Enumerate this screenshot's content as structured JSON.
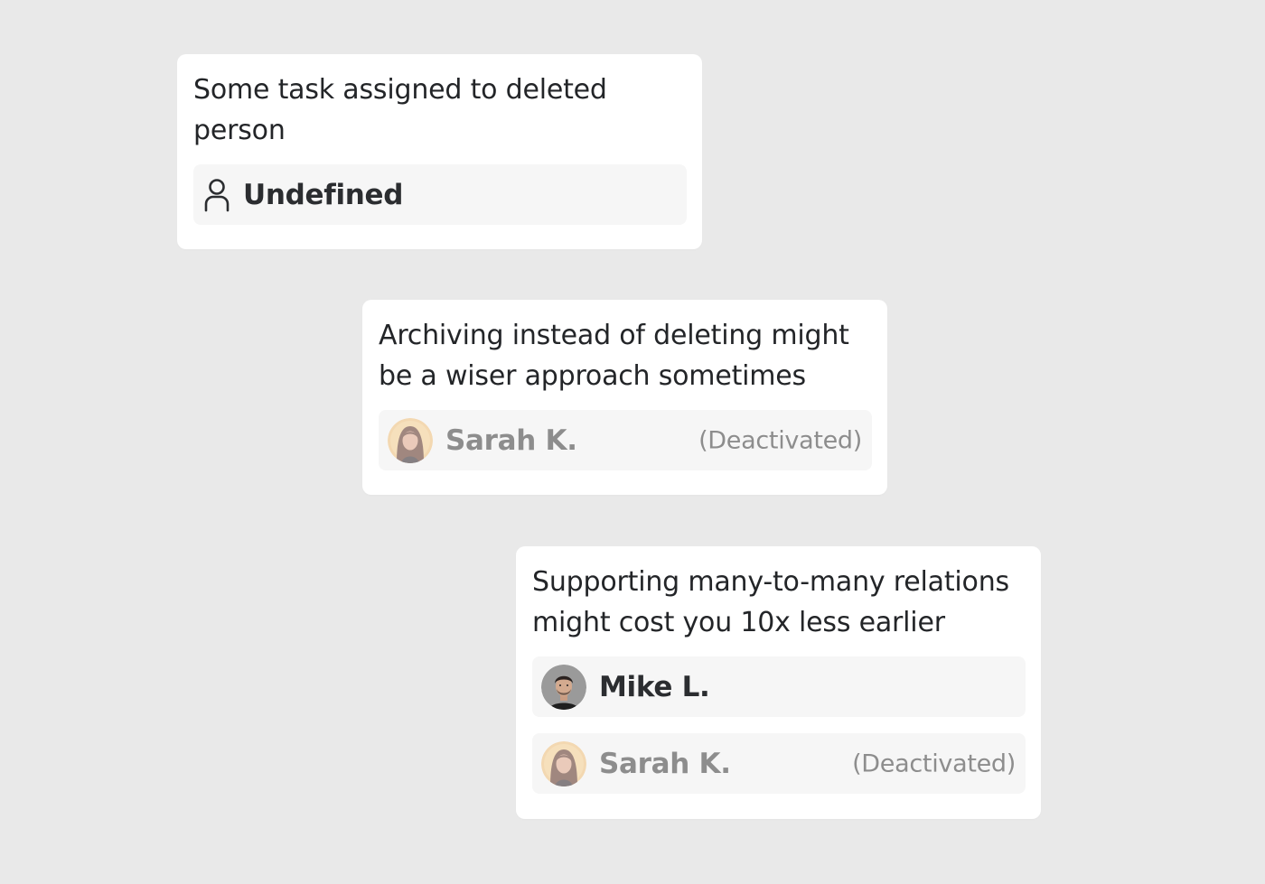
{
  "cards": [
    {
      "title_line1": "Some task assigned to deleted",
      "title_line2": "person",
      "assignees": [
        {
          "name": "Undefined",
          "icon": "user-outline-icon"
        }
      ]
    },
    {
      "title_line1": "Archiving instead of deleting might",
      "title_line2": "be a wiser approach sometimes",
      "assignees": [
        {
          "name": "Sarah K.",
          "status": "(Deactivated)",
          "icon": "avatar-sarah"
        }
      ]
    },
    {
      "title_line1": "Supporting many-to-many relations",
      "title_line2": "might cost you 10x less earlier",
      "assignees": [
        {
          "name": "Mike L.",
          "icon": "avatar-mike"
        },
        {
          "name": "Sarah K.",
          "status": "(Deactivated)",
          "icon": "avatar-sarah"
        }
      ]
    }
  ],
  "colors": {
    "background": "#e9e9e9",
    "card": "#ffffff",
    "row": "#f6f6f6",
    "text": "#232528",
    "muted": "#8d8d8d"
  }
}
